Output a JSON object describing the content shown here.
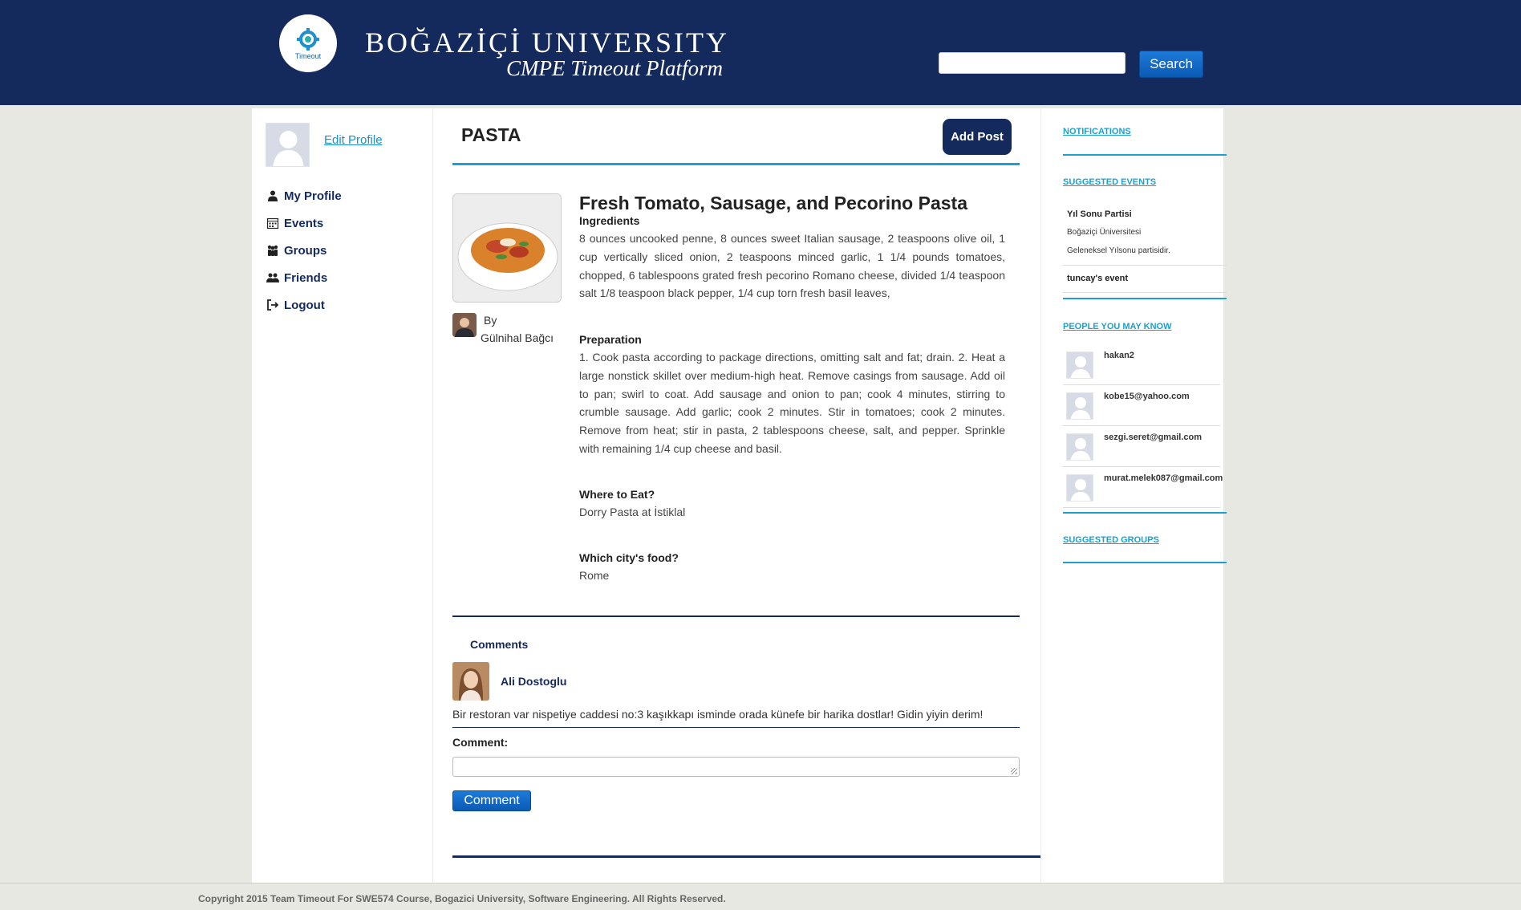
{
  "header": {
    "logo_small_text": "Timeout",
    "brand_title": "BOĞAZİÇİ UNIVERSITY",
    "brand_subtitle": "CMPE Timeout Platform",
    "search_placeholder": "",
    "search_button": "Search"
  },
  "sidebar": {
    "edit_profile": "Edit Profile",
    "items": [
      {
        "label": "My Profile",
        "icon": "user-icon"
      },
      {
        "label": "Events",
        "icon": "calendar-icon"
      },
      {
        "label": "Groups",
        "icon": "group-icon"
      },
      {
        "label": "Friends",
        "icon": "friends-icon"
      },
      {
        "label": "Logout",
        "icon": "logout-icon"
      }
    ]
  },
  "main": {
    "page_title": "PASTA",
    "add_post": "Add Post",
    "post": {
      "title": "Fresh Tomato, Sausage, and Pecorino Pasta",
      "by_label": "By",
      "author": "Gülnihal Bağcı",
      "ingredients_heading": "Ingredients",
      "ingredients": "8 ounces uncooked penne, 8 ounces sweet Italian sausage, 2 teaspoons olive oil, 1 cup vertically sliced onion, 2 teaspoons minced garlic, 1 1/4 pounds tomatoes, chopped, 6 tablespoons grated fresh pecorino Romano cheese, divided 1/4 teaspoon salt 1/8 teaspoon black pepper, 1/4 cup torn fresh basil leaves,",
      "preparation_heading": "Preparation",
      "preparation": "1. Cook pasta according to package directions, omitting salt and fat; drain. 2. Heat a large nonstick skillet over medium-high heat. Remove casings from sausage. Add oil to pan; swirl to coat. Add sausage and onion to pan; cook 4 minutes, stirring to crumble sausage. Add garlic; cook 2 minutes. Stir in tomatoes; cook 2 minutes. Remove from heat; stir in pasta, 2 tablespoons cheese, salt, and pepper. Sprinkle with remaining 1/4 cup cheese and basil.",
      "where_heading": "Where to Eat?",
      "where": "Dorry Pasta at İstiklal",
      "city_heading": "Which city's food?",
      "city": "Rome"
    },
    "comments": {
      "title": "Comments",
      "items": [
        {
          "author": "Ali Dostoglu",
          "text": "Bir restoran var nispetiye caddesi no:3 kaşıkkapı isminde orada künefe bir harika dostlar! Gidin yiyin derim!"
        }
      ],
      "input_label": "Comment:",
      "button": "Comment"
    }
  },
  "right": {
    "notifications": "NOTIFICATIONS",
    "suggested_events": "SUGGESTED EVENTS",
    "events": [
      {
        "title": "Yıl Sonu Partisi",
        "lines": [
          "Boğaziçi Üniversitesi",
          "Geleneksel Yılsonu partisidir."
        ]
      },
      {
        "title": "tuncay's event",
        "lines": []
      }
    ],
    "people_heading": "PEOPLE YOU MAY KNOW",
    "people": [
      "hakan2",
      "kobe15@yahoo.com",
      "sezgi.seret@gmail.com",
      "murat.melek087@gmail.com"
    ],
    "suggested_groups": "SUGGESTED GROUPS"
  },
  "footer": {
    "text": "Copyright 2015 Team Timeout For SWE574 Course, Bogazici University, Software Engineering. All Rights Reserved."
  },
  "colors": {
    "header_bg": "#142a5c",
    "accent": "#1ba0cf",
    "button_blue": "#0a5bb5"
  }
}
